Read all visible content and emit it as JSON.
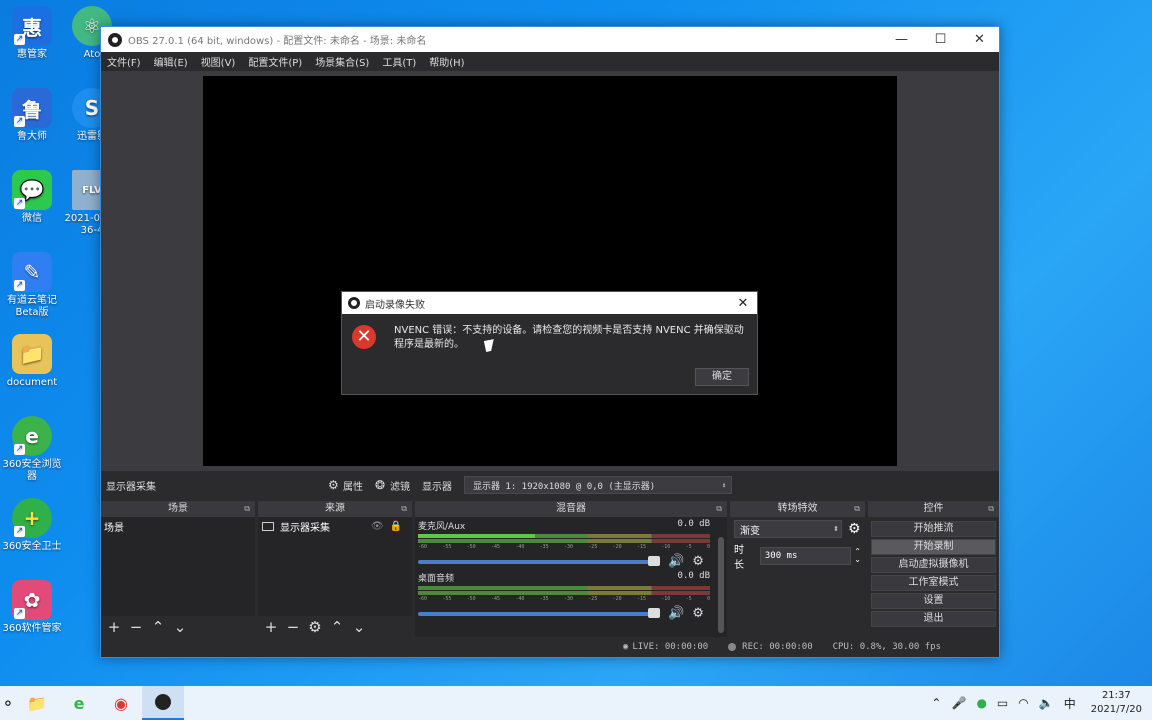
{
  "desktop": {
    "icons": [
      {
        "label": "惠管家",
        "glyph": "惠",
        "color": "#1c6fe0"
      },
      {
        "label": "鲁大师",
        "glyph": "鲁",
        "color": "#2a6ad8"
      },
      {
        "label": "微信",
        "glyph": "💬",
        "color": "#2dc94e"
      },
      {
        "label": "有道云笔记 Beta版",
        "glyph": "✎",
        "color": "#2f7ef2"
      },
      {
        "label": "document",
        "glyph": "📁",
        "color": "#e8c35a"
      },
      {
        "label": "360安全浏览器",
        "glyph": "e",
        "color": "#3bb34a"
      },
      {
        "label": "360安全卫士",
        "glyph": "+",
        "color": "#2fb04a"
      },
      {
        "label": "360软件管家",
        "glyph": "✿",
        "color": "#e24a7a"
      },
      {
        "label": "Ato",
        "glyph": "⚛",
        "color": "#42b883"
      },
      {
        "label": "迅雷影",
        "glyph": "S",
        "color": "#1d8ef0"
      },
      {
        "label": "2021-0 21-36-4",
        "glyph": "FLV",
        "color": "#8fb0d0"
      }
    ]
  },
  "window": {
    "title": "OBS 27.0.1 (64 bit, windows) - 配置文件: 未命名 - 场景: 未命名",
    "minimize": "—",
    "maximize": "☐",
    "close": "✕"
  },
  "menu": [
    "文件(F)",
    "编辑(E)",
    "视图(V)",
    "配置文件(P)",
    "场景集合(S)",
    "工具(T)",
    "帮助(H)"
  ],
  "source_toolbar": {
    "source_name": "显示器采集",
    "properties": "属性",
    "filters": "滤镜",
    "display_label": "显示器",
    "display_value": "显示器 1: 1920x1080 @ 0,0 (主显示器)"
  },
  "docks": {
    "scenes": {
      "title": "场景",
      "items": [
        "场景"
      ]
    },
    "sources": {
      "title": "来源",
      "items": [
        "显示器采集"
      ]
    },
    "mixer": {
      "title": "混音器",
      "tracks": [
        {
          "name": "麦克风/Aux",
          "db": "0.0 dB"
        },
        {
          "name": "桌面音频",
          "db": "0.0 dB"
        }
      ],
      "ticks": [
        "-60",
        "-55",
        "-50",
        "-45",
        "-40",
        "-35",
        "-30",
        "-25",
        "-20",
        "-15",
        "-10",
        "-5",
        "0"
      ]
    },
    "transitions": {
      "title": "转场特效",
      "type": "渐变",
      "duration_label": "时长",
      "duration": "300 ms"
    },
    "controls": {
      "title": "控件",
      "buttons": [
        "开始推流",
        "开始录制",
        "启动虚拟摄像机",
        "工作室模式",
        "设置",
        "退出"
      ]
    }
  },
  "status": {
    "live": "LIVE: 00:00:00",
    "rec": "REC: 00:00:00",
    "cpu": "CPU: 0.8%, 30.00 fps"
  },
  "dialog": {
    "title": "启动录像失败",
    "message": "NVENC 错误：不支持的设备。请检查您的视频卡是否支持 NVENC 并确保驱动程序是最新的。",
    "ok": "确定"
  },
  "taskbar": {
    "time": "21:37",
    "date": "2021/7/20",
    "input_method": "中"
  }
}
